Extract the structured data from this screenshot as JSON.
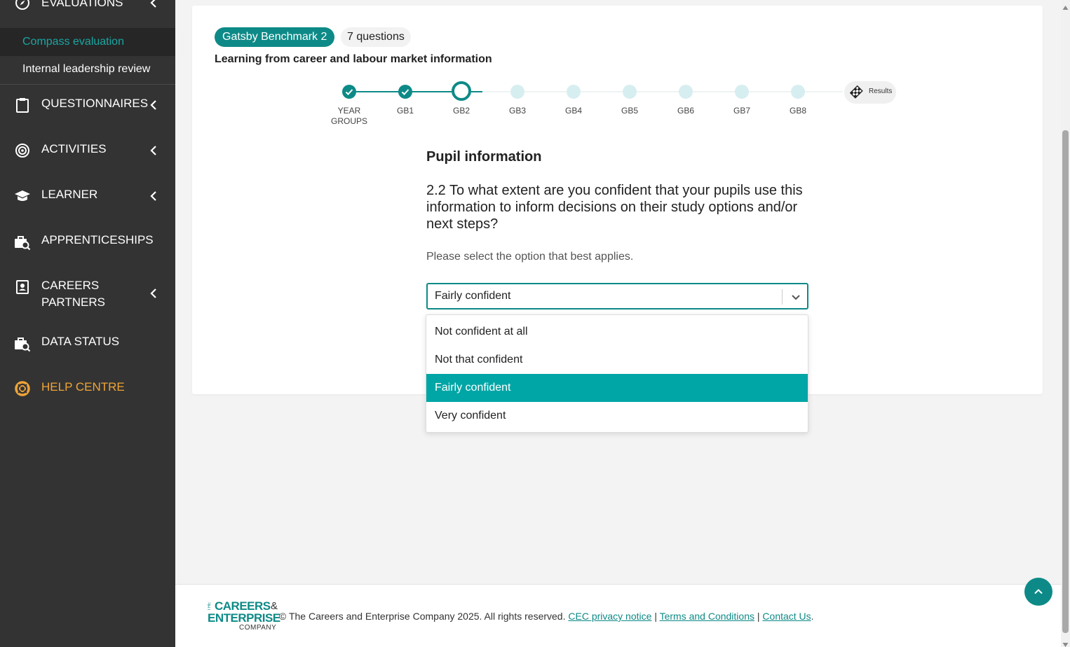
{
  "sidebar": {
    "evaluations_label": "EVALUATIONS",
    "sub_items": [
      "Compass evaluation",
      "Internal leadership review"
    ],
    "items": [
      {
        "label": "QUESTIONNAIRES",
        "icon": "clipboard-icon"
      },
      {
        "label": "ACTIVITIES",
        "icon": "target-icon"
      },
      {
        "label": "LEARNER",
        "icon": "graduation-cap-icon"
      },
      {
        "label": "APPRENTICESHIPS",
        "icon": "briefcase-search-icon"
      },
      {
        "label_line1": "CAREERS",
        "label_line2": "PARTNERS",
        "icon": "contact-card-icon"
      },
      {
        "label": "DATA STATUS",
        "icon": "briefcase-search-icon"
      },
      {
        "label": "HELP CENTRE",
        "icon": "lifebuoy-icon"
      }
    ],
    "help_color": "#f0a436"
  },
  "header": {
    "badge": "Gatsby Benchmark 2",
    "question_count": "7 questions",
    "subtitle": "Learning from career and labour market information"
  },
  "stepper": {
    "steps": [
      {
        "label_line1": "YEAR",
        "label_line2": "GROUPS",
        "state": "complete"
      },
      {
        "label_line1": "GB1",
        "label_line2": "",
        "state": "complete"
      },
      {
        "label_line1": "GB2",
        "label_line2": "",
        "state": "current"
      },
      {
        "label_line1": "GB3",
        "label_line2": "",
        "state": "upcoming"
      },
      {
        "label_line1": "GB4",
        "label_line2": "",
        "state": "upcoming"
      },
      {
        "label_line1": "GB5",
        "label_line2": "",
        "state": "upcoming"
      },
      {
        "label_line1": "GB6",
        "label_line2": "",
        "state": "upcoming"
      },
      {
        "label_line1": "GB7",
        "label_line2": "",
        "state": "upcoming"
      },
      {
        "label_line1": "GB8",
        "label_line2": "",
        "state": "upcoming"
      }
    ],
    "results_label": "Results"
  },
  "question": {
    "section_title": "Pupil information",
    "text": "2.2 To what extent are you confident that your pupils use this information to inform decisions on their study options and/or next steps?",
    "hint": "Please select the option that best applies.",
    "selected_value": "Fairly confident",
    "options": [
      "Not confident at all",
      "Not that confident",
      "Fairly confident",
      "Very confident"
    ],
    "selected_index": 2
  },
  "footer": {
    "logo_the": "THE",
    "logo_line1": "CAREERS",
    "logo_amp": "&",
    "logo_line2": "ENTERPRISE",
    "logo_line3": "COMPANY",
    "copyright": "© The Careers and Enterprise Company 2025. All rights reserved.",
    "links": [
      "CEC privacy notice",
      "Terms and Conditions",
      "Contact Us"
    ],
    "separator": "|",
    "end": "."
  },
  "colors": {
    "accent": "#0d8a87",
    "selected_option": "#00a6a6",
    "sidebar_bg": "#333333",
    "step_upcoming": "#d7eef0"
  }
}
